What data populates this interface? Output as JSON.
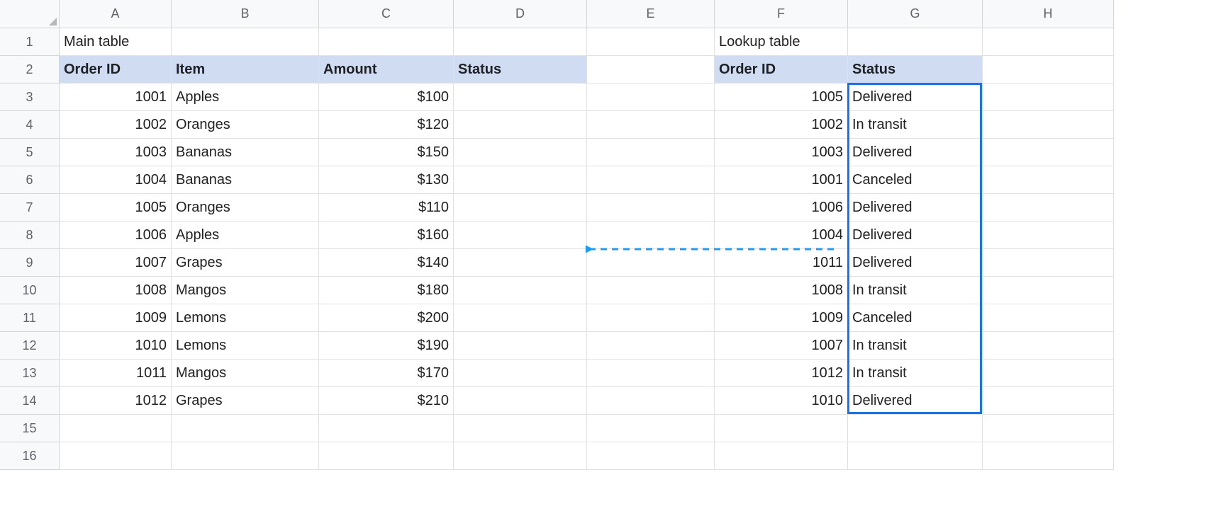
{
  "columns": [
    "A",
    "B",
    "C",
    "D",
    "E",
    "F",
    "G",
    "H"
  ],
  "rowNumbers": [
    "1",
    "2",
    "3",
    "4",
    "5",
    "6",
    "7",
    "8",
    "9",
    "10",
    "11",
    "12",
    "13",
    "14",
    "15",
    "16"
  ],
  "titles": {
    "main": "Main table",
    "lookup": "Lookup table"
  },
  "headers": {
    "mainA": "Order ID",
    "mainB": "Item",
    "mainC": "Amount",
    "mainD": "Status",
    "lookupF": "Order ID",
    "lookupG": "Status"
  },
  "chart_data": {
    "type": "table",
    "main_table": {
      "columns": [
        "Order ID",
        "Item",
        "Amount",
        "Status"
      ],
      "rows": [
        {
          "order_id": "1001",
          "item": "Apples",
          "amount": "$100",
          "status": ""
        },
        {
          "order_id": "1002",
          "item": "Oranges",
          "amount": "$120",
          "status": ""
        },
        {
          "order_id": "1003",
          "item": "Bananas",
          "amount": "$150",
          "status": ""
        },
        {
          "order_id": "1004",
          "item": "Bananas",
          "amount": "$130",
          "status": ""
        },
        {
          "order_id": "1005",
          "item": "Oranges",
          "amount": "$110",
          "status": ""
        },
        {
          "order_id": "1006",
          "item": "Apples",
          "amount": "$160",
          "status": ""
        },
        {
          "order_id": "1007",
          "item": "Grapes",
          "amount": "$140",
          "status": ""
        },
        {
          "order_id": "1008",
          "item": "Mangos",
          "amount": "$180",
          "status": ""
        },
        {
          "order_id": "1009",
          "item": "Lemons",
          "amount": "$200",
          "status": ""
        },
        {
          "order_id": "1010",
          "item": "Lemons",
          "amount": "$190",
          "status": ""
        },
        {
          "order_id": "1011",
          "item": "Mangos",
          "amount": "$170",
          "status": ""
        },
        {
          "order_id": "1012",
          "item": "Grapes",
          "amount": "$210",
          "status": ""
        }
      ]
    },
    "lookup_table": {
      "columns": [
        "Order ID",
        "Status"
      ],
      "rows": [
        {
          "order_id": "1005",
          "status": "Delivered"
        },
        {
          "order_id": "1002",
          "status": "In transit"
        },
        {
          "order_id": "1003",
          "status": "Delivered"
        },
        {
          "order_id": "1001",
          "status": "Canceled"
        },
        {
          "order_id": "1006",
          "status": "Delivered"
        },
        {
          "order_id": "1004",
          "status": "Delivered"
        },
        {
          "order_id": "1011",
          "status": "Delivered"
        },
        {
          "order_id": "1008",
          "status": "In transit"
        },
        {
          "order_id": "1009",
          "status": "Canceled"
        },
        {
          "order_id": "1007",
          "status": "In transit"
        },
        {
          "order_id": "1012",
          "status": "In transit"
        },
        {
          "order_id": "1010",
          "status": "Delivered"
        }
      ]
    }
  }
}
